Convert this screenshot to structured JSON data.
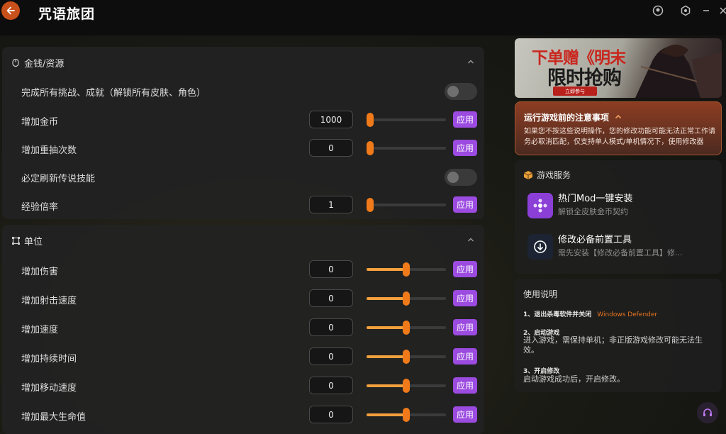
{
  "app": {
    "title": "咒语旅团"
  },
  "colors": {
    "accent_orange": "#f07a1a",
    "apply_purple": "#9b4be0",
    "slider_fill": "#f2a03c"
  },
  "sections": {
    "money": {
      "title": "金钱/资源",
      "rows": [
        {
          "label": "完成所有挑战、成就（解锁所有皮肤、角色）",
          "type": "toggle",
          "on": false
        },
        {
          "label": "增加金币",
          "type": "slider",
          "value": "1000",
          "slider_fraction": 0.0,
          "apply": "应用"
        },
        {
          "label": "增加重抽次数",
          "type": "slider",
          "value": "0",
          "slider_fraction": 0.0,
          "apply": "应用"
        },
        {
          "label": "必定刷新传说技能",
          "type": "toggle",
          "on": false
        },
        {
          "label": "经验倍率",
          "type": "slider",
          "value": "1",
          "slider_fraction": 0.0,
          "apply": "应用"
        }
      ]
    },
    "unit": {
      "title": "单位",
      "rows": [
        {
          "label": "增加伤害",
          "value": "0",
          "slider_fraction": 0.5,
          "apply": "应用"
        },
        {
          "label": "增加射击速度",
          "value": "0",
          "slider_fraction": 0.5,
          "apply": "应用"
        },
        {
          "label": "增加速度",
          "value": "0",
          "slider_fraction": 0.5,
          "apply": "应用"
        },
        {
          "label": "增加持续时间",
          "value": "0",
          "slider_fraction": 0.5,
          "apply": "应用"
        },
        {
          "label": "增加移动速度",
          "value": "0",
          "slider_fraction": 0.5,
          "apply": "应用"
        },
        {
          "label": "增加最大生命值",
          "value": "0",
          "slider_fraction": 0.5,
          "apply": "应用"
        }
      ]
    }
  },
  "banner": {
    "title": "下单赠《明末",
    "subtitle": "限时抢购",
    "button": "立即参与"
  },
  "notice": {
    "title": "运行游戏前的注意事项",
    "body": "如果您不按这些说明操作，您的修改功能可能无法正常工作请务必取消匹配，仅支持单人模式/单机情况下，使用修改器"
  },
  "services": {
    "title": "游戏服务",
    "items": [
      {
        "title": "热门Mod一键安装",
        "desc": "解锁全皮肤金币契约"
      },
      {
        "title": "修改必备前置工具",
        "desc": "需先安装【修改必备前置工具】修..."
      }
    ]
  },
  "guide": {
    "title": "使用说明",
    "step1": "1、退出杀毒软件并关闭",
    "step1_highlight": "Windows Defender",
    "step2": "2、启动游戏",
    "step2_text": "进入游戏，需保持单机；非正版游戏修改可能无法生效。",
    "step3": "3、开启修改",
    "step3_text": "启动游戏成功后，开启修改。"
  }
}
